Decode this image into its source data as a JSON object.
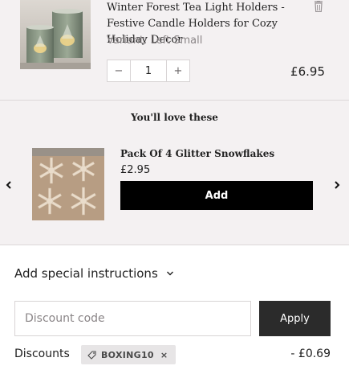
{
  "cart_item": {
    "title": "Winter Forest Tea Light Holders - Festive Candle Holders for Cozy Holiday Decor",
    "variant": "Variant: Left Small",
    "quantity": "1",
    "minus": "−",
    "plus": "+",
    "price": "£6.95",
    "delete_icon": "trash-icon",
    "image_icon": "candle-holders-photo"
  },
  "recommendations": {
    "heading": "You'll love these",
    "left_arrow": "chevron-left-icon",
    "right_arrow": "chevron-right-icon",
    "product": {
      "name": "Pack Of 4 Glitter Snowflakes",
      "price": "£2.95",
      "add_label": "Add",
      "image_icon": "snowflakes-photo"
    }
  },
  "footer": {
    "instructions_label": "Add special instructions",
    "instructions_icon": "chevron-down-icon",
    "discount_placeholder": "Discount code",
    "apply_label": "Apply",
    "discounts_label": "Discounts",
    "discount_code": "BOXING10",
    "tag_icon": "tag-icon",
    "remove_icon": "×",
    "discount_amount": "- £0.69"
  },
  "colors": {
    "panel_bg": "#f4f1f2",
    "button_black": "#000000",
    "apply_button": "#2b2b2b",
    "muted_text": "#8a8587",
    "chip_bg": "#e7e5e6"
  }
}
